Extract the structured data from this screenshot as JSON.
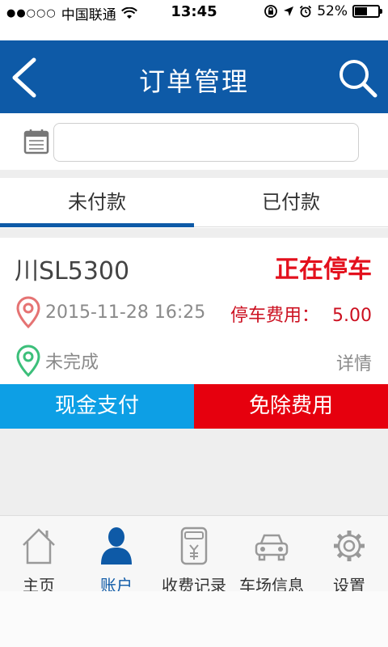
{
  "status_bar": {
    "signal_dots": "●●○○○",
    "carrier": "中国联通",
    "time": "13:45",
    "battery": "52%",
    "battery_level": 0.52
  },
  "header": {
    "title": "订单管理",
    "back_icon": "chevron-left-icon",
    "search_icon": "search-icon",
    "color": "#0e5aa7"
  },
  "date_filter": {
    "icon": "calendar-icon",
    "value": "",
    "placeholder": ""
  },
  "tabs": [
    {
      "label": "未付款",
      "active": true
    },
    {
      "label": "已付款",
      "active": false
    }
  ],
  "order": {
    "plate": "川SL5300",
    "status": "正在停车",
    "time": "2015-11-28 16:25",
    "fee_label": "停车费用：",
    "fee_value": "5.00",
    "state": "未完成",
    "details_label": "详情"
  },
  "actions": {
    "cash_label": "现金支付",
    "cash_color": "#0d9fe5",
    "waive_label": "免除费用",
    "waive_color": "#e6000e"
  },
  "bottom_nav": [
    {
      "label": "主页",
      "icon": "home-icon",
      "active": false
    },
    {
      "label": "账户",
      "icon": "user-icon",
      "active": true
    },
    {
      "label": "收费记录",
      "icon": "receipt-icon",
      "active": false
    },
    {
      "label": "车场信息",
      "icon": "car-icon",
      "active": false
    },
    {
      "label": "设置",
      "icon": "gear-icon",
      "active": false
    }
  ]
}
